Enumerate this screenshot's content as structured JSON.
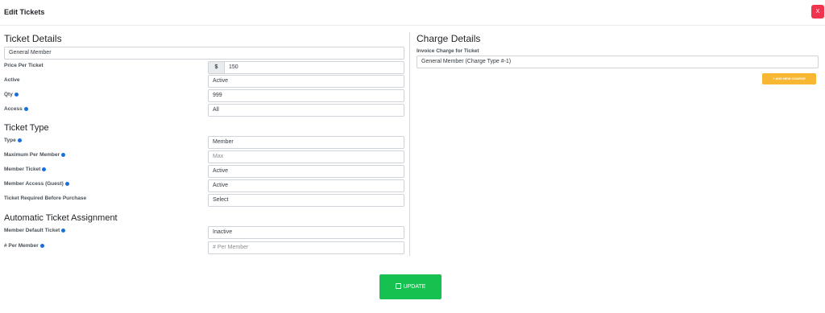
{
  "modal": {
    "title": "Edit Tickets",
    "close_label": "X"
  },
  "ticket_details": {
    "title": "Ticket Details",
    "name_value": "General Member",
    "price_label": "Price Per Ticket",
    "currency": "$",
    "price_value": "150",
    "active_label": "Active",
    "active_value": "Active",
    "qty_label": "Qty",
    "qty_value": "999",
    "access_label": "Access",
    "access_value": "All"
  },
  "ticket_type": {
    "title": "Ticket Type",
    "type_label": "Type",
    "type_value": "Member",
    "max_label": "Maximum Per Member",
    "max_placeholder": "Max",
    "member_ticket_label": "Member Ticket",
    "member_ticket_value": "Active",
    "guest_label": "Member Access (Guest)",
    "guest_value": "Active",
    "required_label": "Ticket Required Before Purchase",
    "required_value": "Select"
  },
  "auto_assignment": {
    "title": "Automatic Ticket Assignment",
    "default_label": "Member Default Ticket",
    "default_value": "Inactive",
    "per_member_label": "# Per Member",
    "per_member_placeholder": "# Per Member"
  },
  "charge_details": {
    "title": "Charge Details",
    "invoice_label": "Invoice Charge for Ticket",
    "invoice_value": "General Member (Charge Type #-1)",
    "add_charge_label": "+ ADD NEW CHARGE"
  },
  "footer": {
    "update_label": "UPDATE"
  },
  "colors": {
    "close": "#f0344f",
    "add_charge": "#f7b733",
    "update": "#17c150",
    "info": "#1b6fd6"
  },
  "icons": {
    "info": "info-icon",
    "save": "save-icon"
  }
}
